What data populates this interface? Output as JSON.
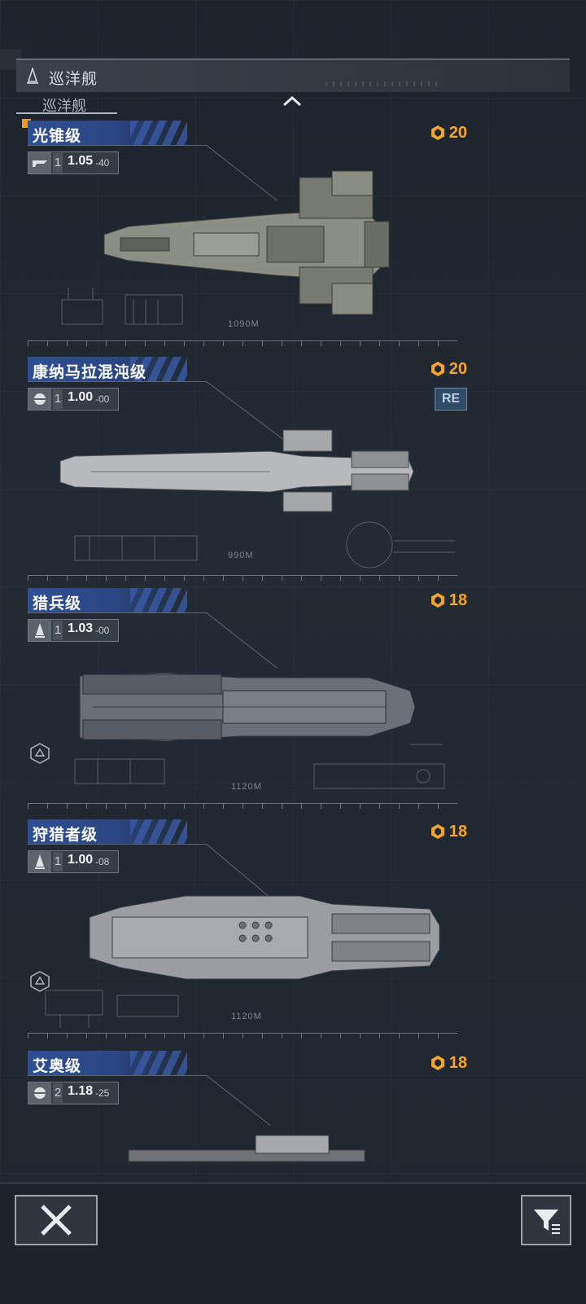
{
  "header": {
    "title": "巡洋舰",
    "ghost_label": "巡洋舰"
  },
  "ships": [
    {
      "name": "光锥级",
      "tier": "1",
      "ratio": "1.05",
      "sub": "40",
      "cost": "20",
      "length": "1090M",
      "re": ""
    },
    {
      "name": "康纳马拉混沌级",
      "tier": "1",
      "ratio": "1.00",
      "sub": "00",
      "cost": "20",
      "length": "990M",
      "re": "RE"
    },
    {
      "name": "猎兵级",
      "tier": "1",
      "ratio": "1.03",
      "sub": "00",
      "cost": "18",
      "length": "1120M",
      "re": ""
    },
    {
      "name": "狩猎者级",
      "tier": "1",
      "ratio": "1.00",
      "sub": "08",
      "cost": "18",
      "length": "1120M",
      "re": ""
    },
    {
      "name": "艾奥级",
      "tier": "2",
      "ratio": "1.18",
      "sub": "25",
      "cost": "18",
      "length": "",
      "re": ""
    }
  ],
  "colors": {
    "accent": "#f4a52a",
    "name_bar": "#2f4f93",
    "background": "#1f262e"
  },
  "icons": {
    "close": "close-icon",
    "filter": "filter-icon",
    "collapse": "chevron-up-icon",
    "cost": "resource-hex-icon"
  }
}
